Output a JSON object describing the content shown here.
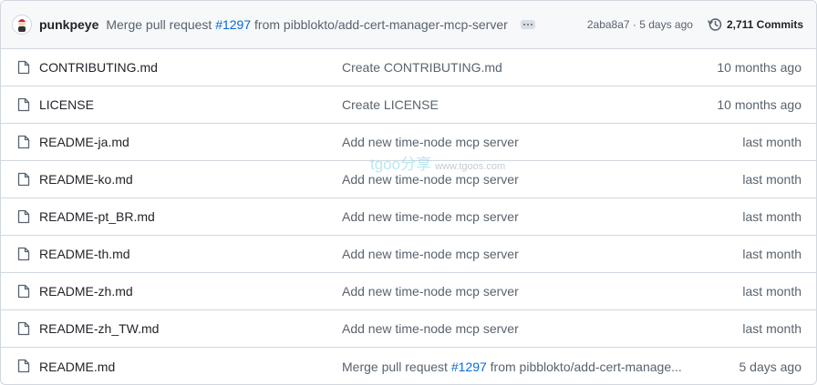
{
  "latest_commit": {
    "author": "punkpeye",
    "message_prefix": "Merge pull request ",
    "pr_number": "#1297",
    "message_suffix": " from pibblokto/add-cert-manager-mcp-server",
    "sha": "2aba8a7",
    "separator": " · ",
    "age": "5 days ago",
    "commit_count": "2,711 Commits"
  },
  "files": [
    {
      "name": "CONTRIBUTING.md",
      "message": "Create CONTRIBUTING.md",
      "age": "10 months ago"
    },
    {
      "name": "LICENSE",
      "message": "Create LICENSE",
      "age": "10 months ago"
    },
    {
      "name": "README-ja.md",
      "message": "Add new time-node mcp server",
      "age": "last month"
    },
    {
      "name": "README-ko.md",
      "message": "Add new time-node mcp server",
      "age": "last month"
    },
    {
      "name": "README-pt_BR.md",
      "message": "Add new time-node mcp server",
      "age": "last month"
    },
    {
      "name": "README-th.md",
      "message": "Add new time-node mcp server",
      "age": "last month"
    },
    {
      "name": "README-zh.md",
      "message": "Add new time-node mcp server",
      "age": "last month"
    },
    {
      "name": "README-zh_TW.md",
      "message": "Add new time-node mcp server",
      "age": "last month"
    },
    {
      "name": "README.md",
      "message_prefix": "Merge pull request ",
      "pr_number": "#1297",
      "message_suffix": " from pibblokto/add-cert-manage...",
      "age": "5 days ago"
    }
  ],
  "watermark": {
    "text": "tgoo分享",
    "url": "www.tgoos.com"
  },
  "icons": {
    "file": "file-icon",
    "history": "history-icon",
    "ellipsis": "ellipsis-icon"
  }
}
